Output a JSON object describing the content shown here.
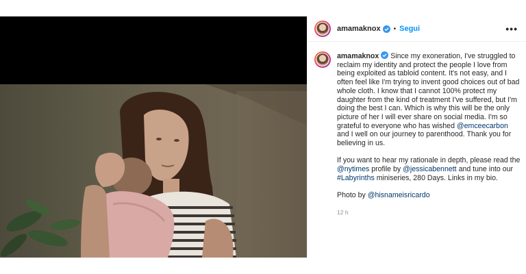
{
  "post": {
    "username": "amamaknox",
    "follow_label": "Segui",
    "separator": "•",
    "more_label": "•••",
    "caption": {
      "p1_a": " Since my exoneration, I've struggled to reclaim my identity and protect the people I love from being exploited as tabloid content. It's not easy, and I often feel like I'm trying to invent good choices out of bad whole cloth. I know that I cannot 100% protect my daughter from the kind of treatment I've suffered, but I'm doing the best I can. Which is why this will be the only picture of her I will ever share on social media. I'm so grateful to everyone who has wished ",
      "mention_emceecarbon": "@emceecarbon",
      "p1_b": " and I well on our journey to parenthood. Thank you for believing in us.",
      "p2_a": "If you want to hear my rationale in depth, please read the ",
      "mention_nytimes": "@nytimes",
      "p2_b": " profile by ",
      "mention_jessicabennett": "@jessicabennett",
      "p2_c": " and tune into our ",
      "hashtag_labyrinths": "#Labyrinths",
      "p2_d": " miniseries, 280 Days. Links in my bio.",
      "p3_a": "Photo by ",
      "mention_photographer": "@hisnameisricardo"
    },
    "timestamp": "12 h",
    "icons": {
      "verified": "verified-badge-icon",
      "more": "more-options-icon"
    },
    "colors": {
      "link": "#00376b",
      "follow": "#0095f6",
      "verified": "#3897f0",
      "muted": "#8e8e8e"
    }
  }
}
